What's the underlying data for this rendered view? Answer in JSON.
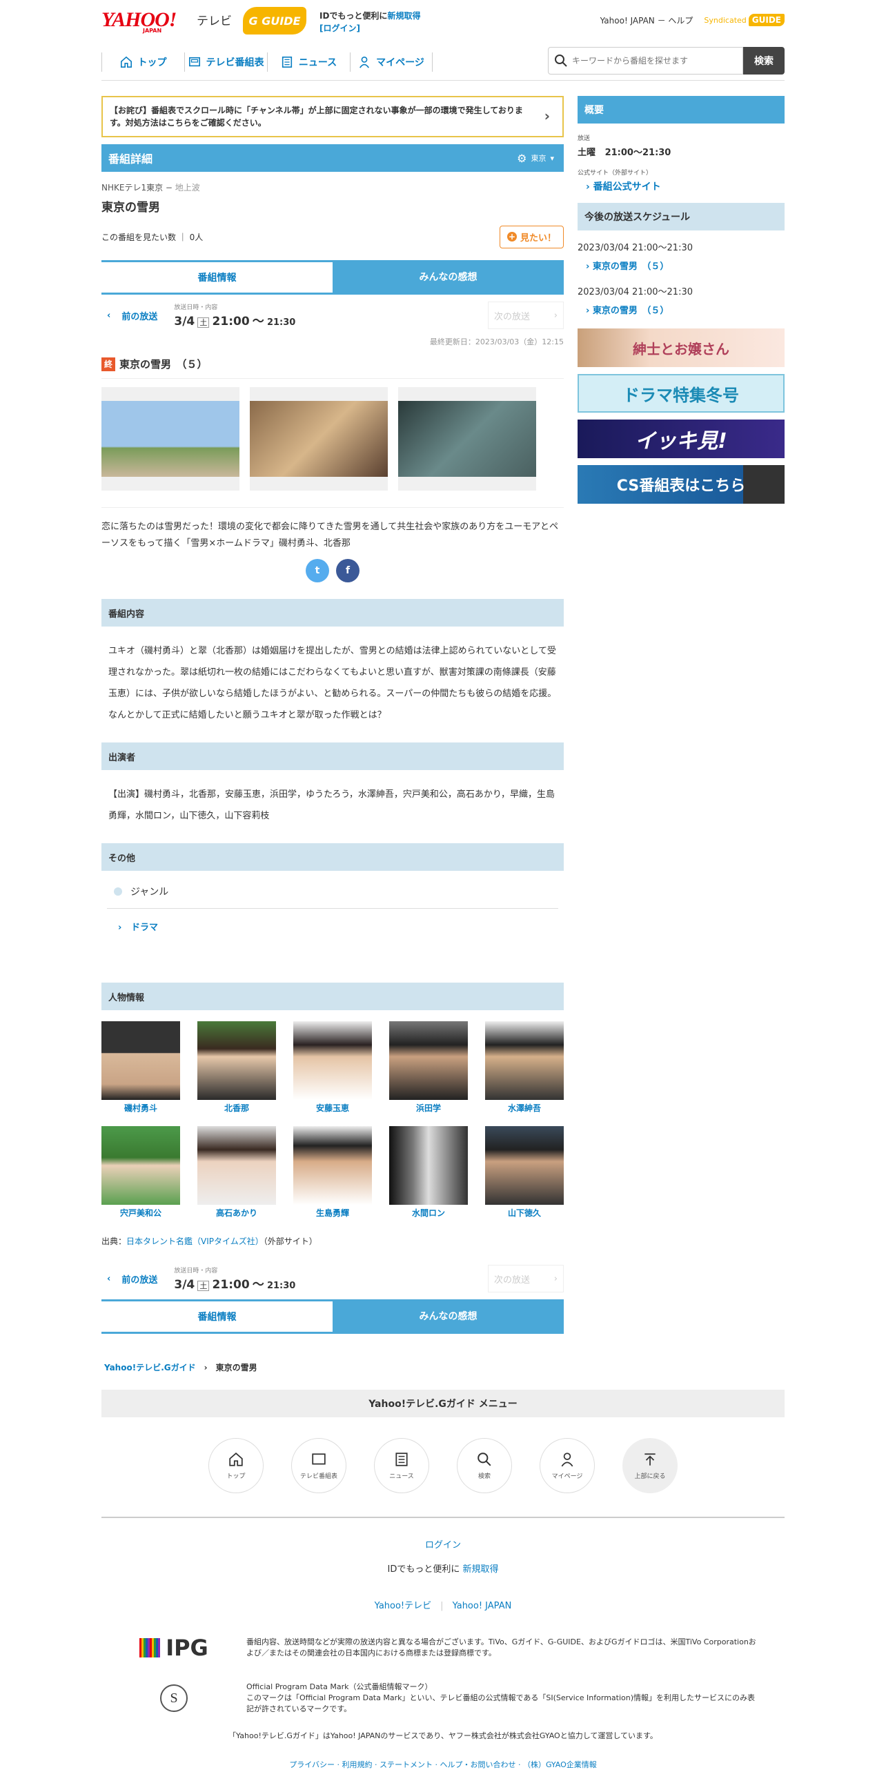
{
  "header": {
    "logo": "YAHOO!",
    "logo_sub": "JAPAN",
    "tv": "テレビ",
    "gguide": "G GUIDE",
    "id_line1": "IDでもっと便利に",
    "signup": "新規取得",
    "login": "[ログイン]",
    "yahoo_japan": "Yahoo! JAPAN",
    "help": "ヘルプ",
    "syndicated": "Syndicated",
    "syn_logo": "GUIDE"
  },
  "nav": {
    "items": [
      {
        "label": "トップ"
      },
      {
        "label": "テレビ番組表"
      },
      {
        "label": "ニュース"
      },
      {
        "label": "マイページ"
      }
    ],
    "search_placeholder": "キーワードから番組を探せます",
    "search_button": "検索"
  },
  "notice": "【お詫び】番組表でスクロール時に「チャンネル帯」が上部に固定されない事象が一部の環境で発生しております。対処方法はこちらをご確認ください。",
  "detail": {
    "section_title": "番組詳細",
    "region": "東京",
    "channel": "NHKEテレ1東京",
    "channel_type": "地上波",
    "title": "東京の雪男",
    "want_label": "この番組を見たい数",
    "want_count": "0人",
    "want_button": "見たい！",
    "tabs": [
      "番組情報",
      "みんなの感想"
    ],
    "prev": "前の放送",
    "next": "次の放送",
    "air_label": "放送日時・内容",
    "air_date": "3/4",
    "air_dow": "土",
    "air_start": "21:00",
    "air_sep": "〜",
    "air_end": "21:30",
    "updated": "最終更新日：2023/03/03（金）12:15",
    "end_mark": "終",
    "episode": "東京の雪男　（５）",
    "description": "恋に落ちたのは雪男だった！環境の変化で都会に降りてきた雪男を通して共生社会や家族のあり方をユーモアとペーソスをもって描く「雪男×ホームドラマ」磯村勇斗、北香那",
    "share": [
      "t",
      "f"
    ]
  },
  "content": {
    "title": "番組内容",
    "text": "ユキオ（磯村勇斗）と翠（北香那）は婚姻届けを提出したが、雪男との結婚は法律上認められていないとして受理されなかった。翠は紙切れ一枚の結婚にはこだわらなくてもよいと思い直すが、獣害対策課の南條課長（安藤玉恵）には、子供が欲しいなら結婚したほうがよい、と勧められる。スーパーの仲間たちも彼らの結婚を応援。なんとかして正式に結婚したいと願うユキオと翠が取った作戦とは？"
  },
  "cast": {
    "title": "出演者",
    "text": "【出演】磯村勇斗，北香那，安藤玉恵，浜田学，ゆうたろう，水澤紳吾，宍戸美和公，高石あかり，早織，生島勇輝，水間ロン，山下徳久，山下容莉枝"
  },
  "other": {
    "title": "その他",
    "genre_label": "ジャンル",
    "genre": "ドラマ"
  },
  "people": {
    "title": "人物情報",
    "list": [
      "磯村勇斗",
      "北香那",
      "安藤玉恵",
      "浜田学",
      "水澤紳吾",
      "宍戸美和公",
      "高石あかり",
      "生島勇輝",
      "水間ロン",
      "山下徳久"
    ],
    "source_prefix": "出典：",
    "source_link": "日本タレント名鑑（VIPタイムズ社）",
    "source_suffix": "（外部サイト）"
  },
  "breadcrumb": {
    "home": "Yahoo!テレビ.Gガイド",
    "current": "東京の雪男"
  },
  "footer": {
    "menu_title": "Yahoo!テレビ.Gガイド メニュー",
    "circles": [
      "トップ",
      "テレビ番組表",
      "ニュース",
      "検索",
      "マイページ",
      "上部に戻る"
    ],
    "login": "ログイン",
    "id_text": "IDでもっと便利に",
    "signup": "新規取得",
    "link1": "Yahoo!テレビ",
    "link2": "Yahoo! JAPAN",
    "ipg": "IPG",
    "ipg_text": "番組内容、放送時間などが実際の放送内容と異なる場合がございます。TiVo、Gガイド、G-GUIDE、およびGガイドロゴは、米国TiVo Corporationおよび／またはその関連会社の日本国内における商標または登録商標です。",
    "opd_title": "Official Program Data Mark（公式番組情報マーク）",
    "opd_text": "このマークは「Official Program Data Mark」といい、テレビ番組の公式情報である「SI(Service Information)情報」を利用したサービスにのみ表記が許されているマークです。",
    "note": "「Yahoo!テレビ.Gガイド」はYahoo! JAPANのサービスであり、ヤフー株式会社が株式会社GYAOと協力して運営しています。",
    "bottom": "プライバシー · 利用規約 · ステートメント · ヘルプ・お問い合わせ · （株）GYAO企業情報"
  },
  "side": {
    "overview": "概要",
    "air_label": "放送",
    "air_dow": "土曜",
    "air_time": "21:00～21:30",
    "site_label": "公式サイト（外部サイト）",
    "site_link": "番組公式サイト",
    "schedule_title": "今後の放送スケジュール",
    "schedule": [
      {
        "dt": "2023/03/04 21:00～21:30",
        "title": "東京の雪男　（５）"
      },
      {
        "dt": "2023/03/04 21:00～21:30",
        "title": "東京の雪男　（５）"
      }
    ],
    "ads": [
      "紳士とお嬢さん",
      "ドラマ特集冬号",
      "イッキ見!",
      "CS番組表はこちら"
    ]
  },
  "colors": {
    "accent": "#4aa8d8",
    "light": "#cfe3ee",
    "link": "#0a7ec2",
    "orange": "#f08a28"
  }
}
